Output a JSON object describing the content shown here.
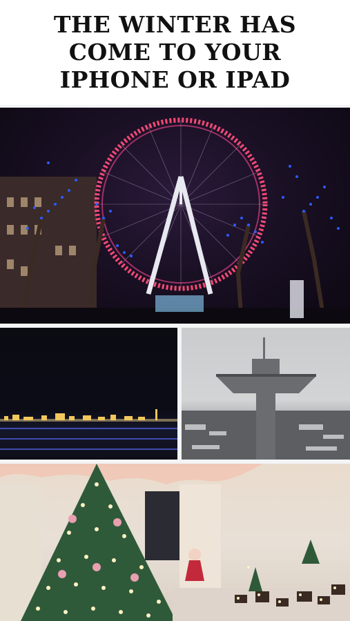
{
  "headline": {
    "lines": [
      "THE WINTER HAS",
      "COME TO YOUR",
      "IPHONE OR IPAD"
    ]
  },
  "photos": [
    {
      "subject": "London Eye ferris wheel illuminated at night with blue-lit trees"
    },
    {
      "subject": "Night city skyline with lights on the horizon"
    },
    {
      "subject": "Concrete observation tower over a snowy town"
    },
    {
      "subject": "Decorated Christmas tree and miniature lit village in a room"
    }
  ],
  "colors": {
    "background": "#f3f4f6",
    "headline_text": "#111111",
    "wheel_lights": "#ff4d7a",
    "tree_lights": "#2b5cff"
  }
}
